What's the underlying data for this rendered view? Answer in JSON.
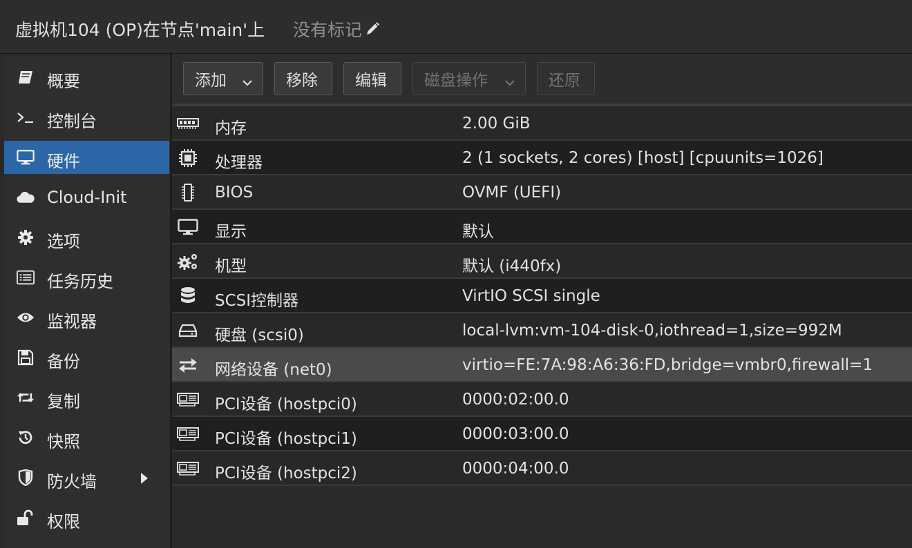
{
  "header": {
    "title": "虚拟机104 (OP)在节点'main'上",
    "tags_label": "没有标记"
  },
  "sidebar": {
    "items": [
      {
        "label": "概要",
        "icon": "book-icon"
      },
      {
        "label": "控制台",
        "icon": "terminal-icon"
      },
      {
        "label": "硬件",
        "icon": "monitor-icon",
        "active": true
      },
      {
        "label": "Cloud-Init",
        "icon": "cloud-icon"
      },
      {
        "label": "选项",
        "icon": "gear-icon"
      },
      {
        "label": "任务历史",
        "icon": "list-icon"
      },
      {
        "label": "监视器",
        "icon": "eye-icon"
      },
      {
        "label": "备份",
        "icon": "floppy-icon"
      },
      {
        "label": "复制",
        "icon": "retweet-icon"
      },
      {
        "label": "快照",
        "icon": "history-icon"
      },
      {
        "label": "防火墙",
        "icon": "shield-icon",
        "has_submenu": true
      },
      {
        "label": "权限",
        "icon": "unlock-icon"
      }
    ]
  },
  "toolbar": {
    "add": "添加",
    "remove": "移除",
    "edit": "编辑",
    "disk_action": "磁盘操作",
    "revert": "还原"
  },
  "hardware": {
    "rows": [
      {
        "name": "内存",
        "value": "2.00 GiB",
        "icon": "memory-icon"
      },
      {
        "name": "处理器",
        "value": "2 (1 sockets, 2 cores) [host] [cpuunits=1026]",
        "icon": "cpu-icon"
      },
      {
        "name": "BIOS",
        "value": "OVMF (UEFI)",
        "icon": "microchip-icon"
      },
      {
        "name": "显示",
        "value": "默认",
        "icon": "desktop-icon"
      },
      {
        "name": "机型",
        "value": "默认 (i440fx)",
        "icon": "cogs-icon"
      },
      {
        "name": "SCSI控制器",
        "value": "VirtIO SCSI single",
        "icon": "database-icon"
      },
      {
        "name": "硬盘 (scsi0)",
        "value": "local-lvm:vm-104-disk-0,iothread=1,size=992M",
        "icon": "hdd-icon"
      },
      {
        "name": "网络设备 (net0)",
        "value": "virtio=FE:7A:98:A6:36:FD,bridge=vmbr0,firewall=1",
        "icon": "exchange-icon",
        "selected": true
      },
      {
        "name": "PCI设备 (hostpci0)",
        "value": "0000:02:00.0",
        "icon": "pci-card-icon"
      },
      {
        "name": "PCI设备 (hostpci1)",
        "value": "0000:03:00.0",
        "icon": "pci-card-icon"
      },
      {
        "name": "PCI设备 (hostpci2)",
        "value": "0000:04:00.0",
        "icon": "pci-card-icon"
      }
    ]
  }
}
